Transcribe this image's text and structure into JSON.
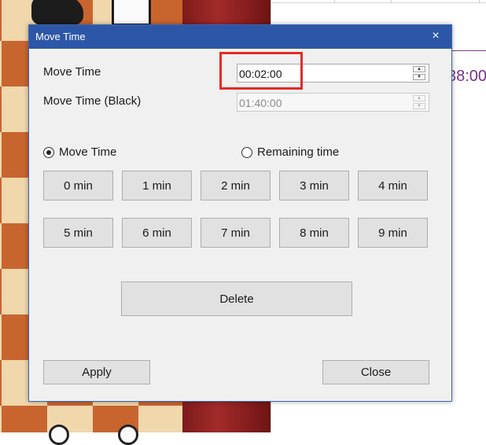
{
  "window": {
    "title": "Move Time",
    "close_glyph": "×"
  },
  "background": {
    "clock_fragment": "38:00"
  },
  "fields": {
    "move_time_label": "Move Time",
    "move_time_value": "00:02:00",
    "move_time_black_label": "Move Time (Black)",
    "move_time_black_value": "01:40:00"
  },
  "mode": {
    "move_time_label": "Move Time",
    "remaining_time_label": "Remaining time",
    "selected": "Move Time"
  },
  "presets": [
    {
      "label": "0 min"
    },
    {
      "label": "1 min"
    },
    {
      "label": "2 min"
    },
    {
      "label": "3 min"
    },
    {
      "label": "4 min"
    },
    {
      "label": "5 min"
    },
    {
      "label": "6 min"
    },
    {
      "label": "7 min"
    },
    {
      "label": "8 min"
    },
    {
      "label": "9 min"
    }
  ],
  "actions": {
    "delete_label": "Delete",
    "apply_label": "Apply",
    "close_label": "Close"
  },
  "colors": {
    "titlebar": "#2c57a8",
    "highlight": "#e32a2a",
    "dialog_bg": "#f0f0f0",
    "button_bg": "#e1e1e1"
  }
}
